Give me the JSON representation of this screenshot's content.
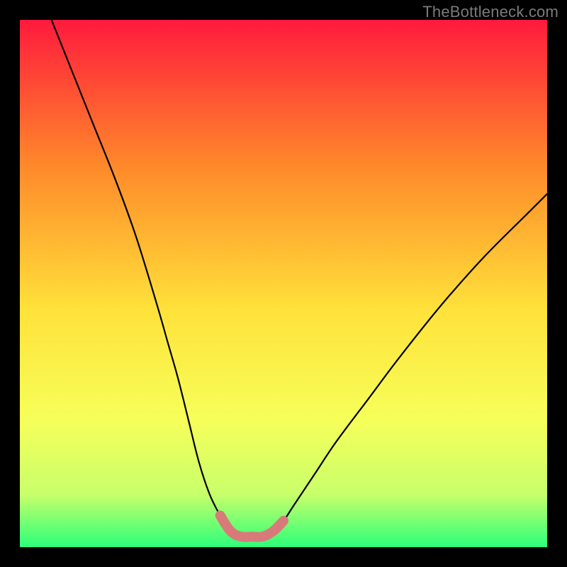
{
  "watermark": {
    "text": "TheBottleneck.com"
  },
  "colors": {
    "background": "#000000",
    "gradient_top": "#ff1a3d",
    "gradient_mid_upper": "#ff8a2a",
    "gradient_mid": "#ffe23a",
    "gradient_mid_lower": "#f6ff5a",
    "gradient_lower": "#c8ff6a",
    "gradient_bottom": "#2cff7a",
    "curve": "#000000",
    "zone": "#d97a7a"
  },
  "chart_data": {
    "type": "line",
    "title": "",
    "xlabel": "",
    "ylabel": "",
    "xlim": [
      0,
      100
    ],
    "ylim": [
      0,
      100
    ],
    "grid": false,
    "legend": false,
    "series": [
      {
        "name": "left-branch",
        "x": [
          6,
          10,
          14,
          18,
          22,
          26,
          28,
          30,
          32,
          34,
          36,
          38,
          40
        ],
        "y": [
          100,
          90,
          80,
          70,
          59,
          46,
          39,
          32,
          24,
          16,
          10,
          6,
          3
        ]
      },
      {
        "name": "right-branch",
        "x": [
          48,
          50,
          52,
          56,
          60,
          66,
          72,
          80,
          88,
          96,
          100
        ],
        "y": [
          3,
          5,
          8,
          14,
          20,
          28,
          36,
          46,
          55,
          63,
          67
        ]
      },
      {
        "name": "optimal-zone",
        "x": [
          38,
          40,
          42,
          44,
          46,
          48,
          50
        ],
        "y": [
          6,
          3,
          2,
          2,
          2,
          3,
          5
        ]
      }
    ],
    "annotations": []
  }
}
